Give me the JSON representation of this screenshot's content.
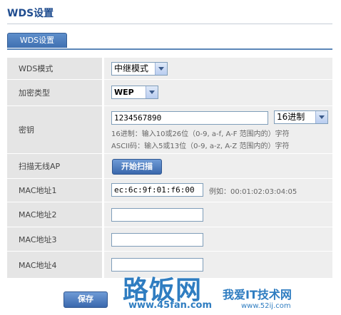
{
  "page_title": "WDS设置",
  "tab_label": "WDS设置",
  "rows": {
    "wds_mode": {
      "label": "WDS模式",
      "value": "中继模式"
    },
    "encryption": {
      "label": "加密类型",
      "value": "WEP"
    },
    "key": {
      "label": "密钥",
      "value": "1234567890",
      "format": "16进制",
      "hint1": "16进制：输入10或26位（0-9, a-f, A-F 范围内的）字符",
      "hint2": "ASCII码：输入5或13位（0-9, a-z, A-Z 范围内的）字符"
    },
    "scan": {
      "label": "扫描无线AP",
      "button": "开始扫描"
    },
    "mac1": {
      "label": "MAC地址1",
      "value": "ec:6c:9f:01:f6:00",
      "example": "例如：00:01:02:03:04:05"
    },
    "mac2": {
      "label": "MAC地址2",
      "value": ""
    },
    "mac3": {
      "label": "MAC地址3",
      "value": ""
    },
    "mac4": {
      "label": "MAC地址4",
      "value": ""
    }
  },
  "save_button": "保存",
  "watermark": {
    "brand1": "路饭网",
    "url1": "www.45fan.com",
    "brand2": "我爱IT技术网",
    "url2": "www.52ij.com"
  },
  "colors": {
    "accent": "#3f70b1",
    "title": "#1f4c8f",
    "label_bg": "#e5e5e5",
    "content_bg": "#eeeeee"
  }
}
